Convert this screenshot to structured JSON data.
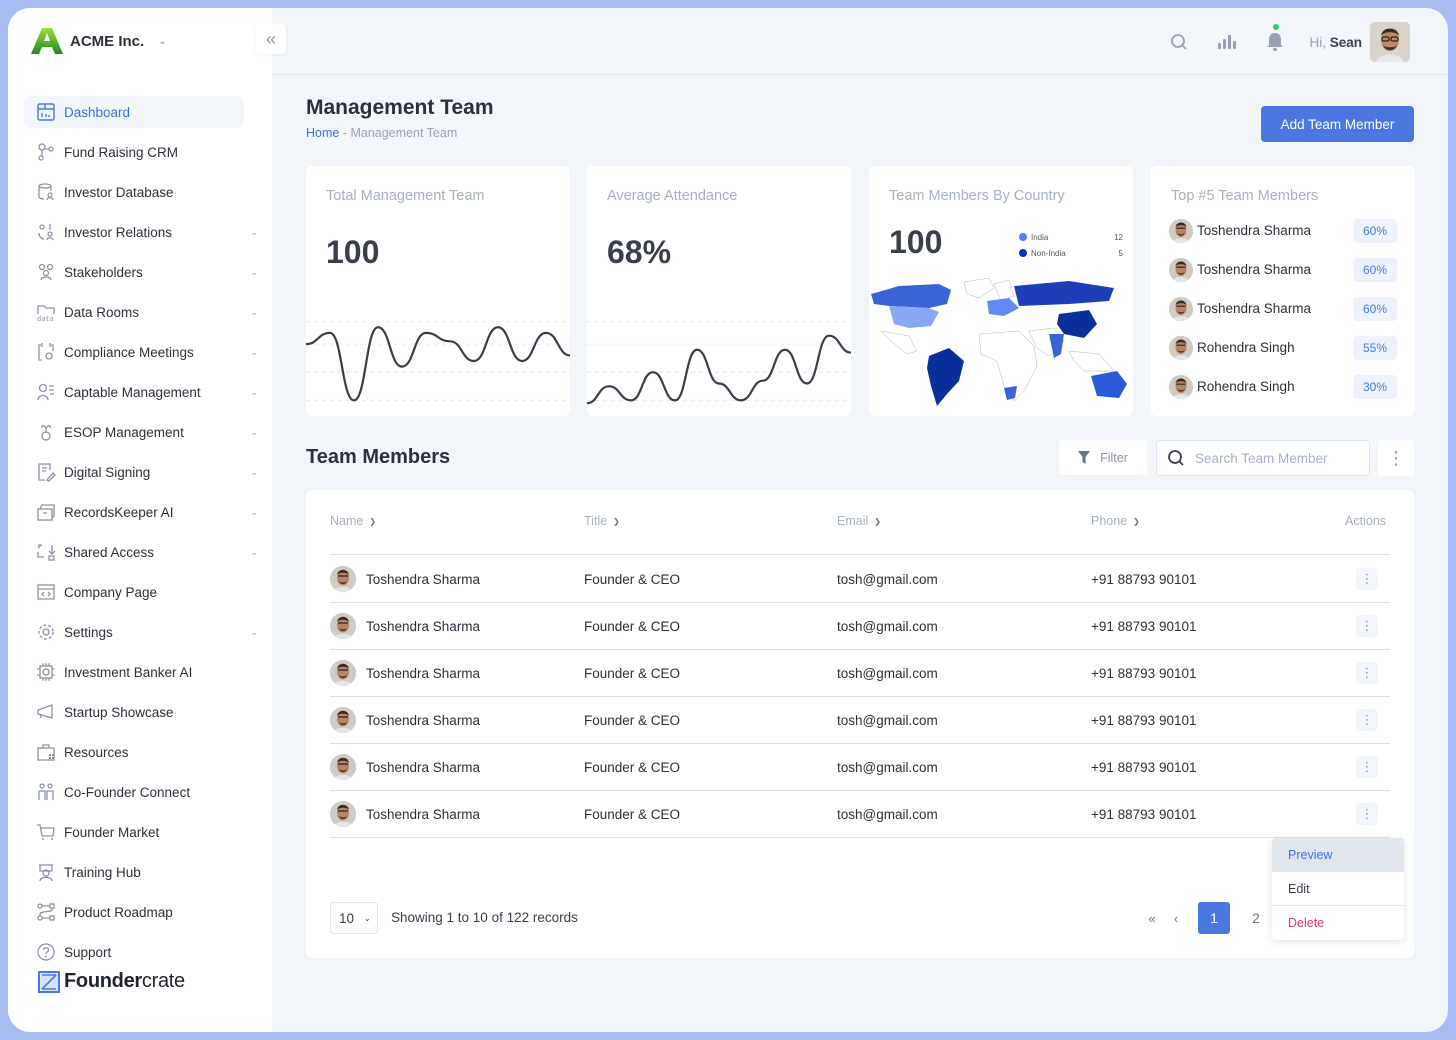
{
  "brand": {
    "name": "ACME Inc."
  },
  "sidebar": {
    "items": [
      {
        "label": "Dashboard",
        "icon": "dashboard-icon",
        "active": true,
        "expandable": false
      },
      {
        "label": "Fund Raising CRM",
        "icon": "crm-icon",
        "expandable": false
      },
      {
        "label": "Investor Database",
        "icon": "database-icon",
        "expandable": false
      },
      {
        "label": "Investor Relations",
        "icon": "investor-relations-icon",
        "expandable": true
      },
      {
        "label": "Stakeholders",
        "icon": "stakeholders-icon",
        "expandable": true
      },
      {
        "label": "Data Rooms",
        "icon": "data-folder-icon",
        "expandable": true
      },
      {
        "label": "Compliance Meetings",
        "icon": "calendar-gear-icon",
        "expandable": true
      },
      {
        "label": "Captable Management",
        "icon": "captable-icon",
        "expandable": true
      },
      {
        "label": "ESOP Management",
        "icon": "esop-icon",
        "expandable": true
      },
      {
        "label": "Digital Signing",
        "icon": "signing-icon",
        "expandable": true
      },
      {
        "label": "RecordsKeeper AI",
        "icon": "archive-icon",
        "expandable": true
      },
      {
        "label": "Shared Access",
        "icon": "shared-access-icon",
        "expandable": true
      },
      {
        "label": "Company Page",
        "icon": "browser-code-icon",
        "expandable": false
      },
      {
        "label": "Settings",
        "icon": "gear-icon",
        "expandable": true
      },
      {
        "label": "Investment Banker AI",
        "icon": "chip-icon",
        "expandable": false
      },
      {
        "label": "Startup Showcase",
        "icon": "megaphone-icon",
        "expandable": false
      },
      {
        "label": "Resources",
        "icon": "briefcase-icon",
        "expandable": false
      },
      {
        "label": "Co-Founder Connect",
        "icon": "cofounder-icon",
        "expandable": false
      },
      {
        "label": "Founder Market",
        "icon": "cart-icon",
        "expandable": false
      },
      {
        "label": "Training Hub",
        "icon": "training-icon",
        "expandable": false
      },
      {
        "label": "Product Roadmap",
        "icon": "roadmap-icon",
        "expandable": false
      },
      {
        "label": "Support",
        "icon": "help-icon",
        "expandable": false
      }
    ],
    "footer_logo": {
      "bold": "Founder",
      "light": "crate"
    }
  },
  "topbar": {
    "greeting_prefix": "Hi,",
    "user_name": "Sean"
  },
  "page": {
    "title": "Management Team",
    "breadcrumb": {
      "home": "Home",
      "separator": " - ",
      "current": "Management Team"
    },
    "add_button": "Add Team Member"
  },
  "cards": {
    "total": {
      "title": "Total Management Team",
      "value": "100"
    },
    "attendance": {
      "title": "Average Attendance",
      "value": "68%"
    },
    "country": {
      "title": "Team Members By Country",
      "value": "100",
      "legend": [
        {
          "label": "India",
          "value": "12",
          "color": "#4f80f0"
        },
        {
          "label": "Non-India",
          "value": "5",
          "color": "#0b2fb8"
        }
      ]
    },
    "top5": {
      "title": "Top #5 Team Members",
      "members": [
        {
          "name": "Toshendra Sharma",
          "pct": "60%"
        },
        {
          "name": "Toshendra Sharma",
          "pct": "60%"
        },
        {
          "name": "Toshendra Sharma",
          "pct": "60%"
        },
        {
          "name": "Rohendra Singh",
          "pct": "55%"
        },
        {
          "name": "Rohendra Singh",
          "pct": "30%"
        }
      ]
    }
  },
  "chart_data": [
    {
      "type": "line",
      "title": "Total Management Team",
      "values": [
        2.2,
        2.6,
        0.2,
        2.8,
        1.4,
        2.6,
        2.3,
        1.6,
        2.8,
        1.6,
        2.6,
        1.8
      ],
      "ylim": [
        0,
        3.2
      ],
      "grid": true
    },
    {
      "type": "line",
      "title": "Average Attendance",
      "values": [
        0.1,
        0.7,
        0.2,
        1.2,
        0.2,
        2.0,
        0.8,
        0.2,
        0.9,
        2.0,
        0.8,
        2.5,
        1.9
      ],
      "ylim": [
        0,
        3.2
      ],
      "grid": true
    }
  ],
  "team": {
    "section_title": "Team Members",
    "filter_label": "Filter",
    "search_placeholder": "Search Team Member",
    "columns": {
      "name": "Name",
      "title": "Title",
      "email": "Email",
      "phone": "Phone",
      "actions": "Actions"
    },
    "rows": [
      {
        "name": "Toshendra Sharma",
        "title": "Founder & CEO",
        "email": "tosh@gmail.com",
        "phone": "+91 88793 90101"
      },
      {
        "name": "Toshendra Sharma",
        "title": "Founder & CEO",
        "email": "tosh@gmail.com",
        "phone": "+91 88793 90101"
      },
      {
        "name": "Toshendra Sharma",
        "title": "Founder & CEO",
        "email": "tosh@gmail.com",
        "phone": "+91 88793 90101"
      },
      {
        "name": "Toshendra Sharma",
        "title": "Founder & CEO",
        "email": "tosh@gmail.com",
        "phone": "+91 88793 90101"
      },
      {
        "name": "Toshendra Sharma",
        "title": "Founder & CEO",
        "email": "tosh@gmail.com",
        "phone": "+91 88793 90101"
      },
      {
        "name": "Toshendra Sharma",
        "title": "Founder & CEO",
        "email": "tosh@gmail.com",
        "phone": "+91 88793 90101"
      }
    ],
    "row_menu": {
      "preview": "Preview",
      "edit": "Edit",
      "delete": "Delete"
    },
    "pagination": {
      "page_size": "10",
      "info": "Showing 1 to 10 of 122 records",
      "first": "«",
      "prev": "‹",
      "pages": [
        "1",
        "2"
      ],
      "current_page": "1"
    }
  }
}
